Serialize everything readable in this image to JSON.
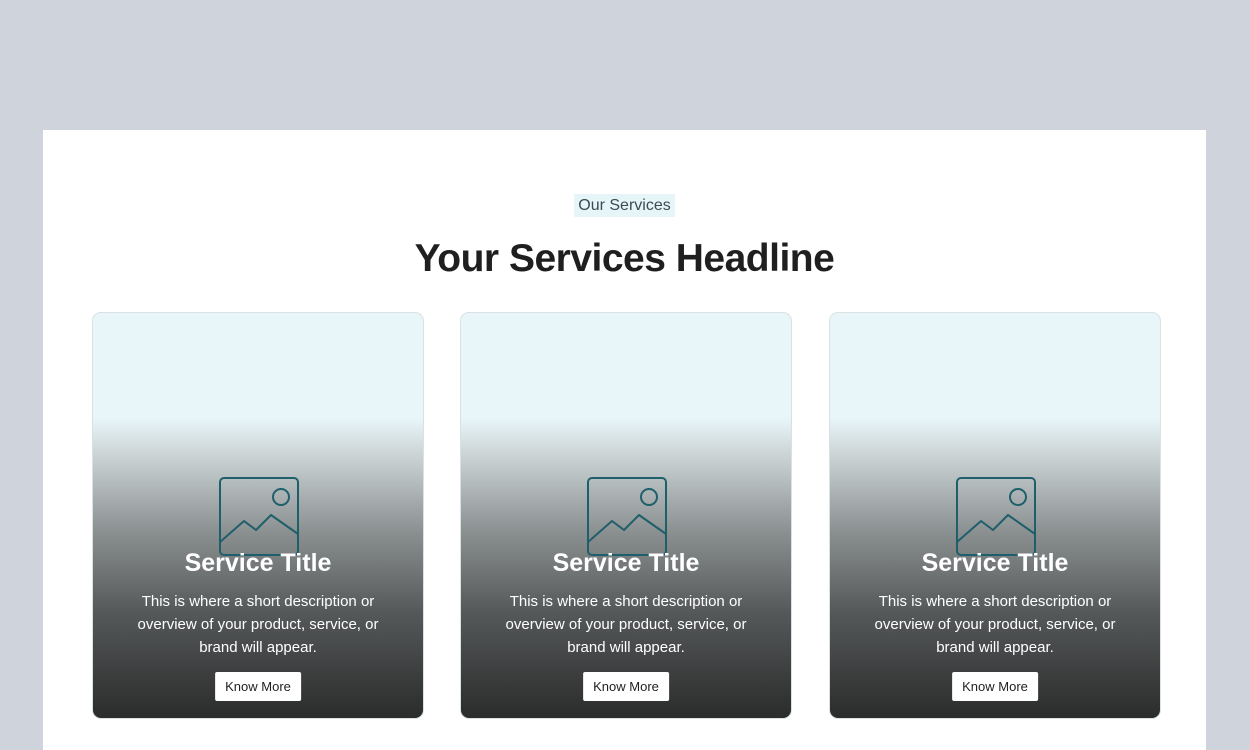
{
  "section": {
    "eyebrow": "Our Services",
    "headline": "Your Services Headline"
  },
  "cards": [
    {
      "icon": "image-placeholder-icon",
      "title": "Service Title",
      "description": "This is where a short description or overview of your product, service, or brand will appear.",
      "button_label": "Know More"
    },
    {
      "icon": "image-placeholder-icon",
      "title": "Service Title",
      "description": "This is where a short description or overview of your product, service, or brand will appear.",
      "button_label": "Know More"
    },
    {
      "icon": "image-placeholder-icon",
      "title": "Service Title",
      "description": "This is where a short description or overview of your product, service, or brand will appear.",
      "button_label": "Know More"
    }
  ],
  "colors": {
    "page_background": "#cfd4dc",
    "panel_background": "#ffffff",
    "eyebrow_background": "#e6f6f8",
    "icon_stroke": "#1f5f6b",
    "card_top": "#e8f6f9",
    "card_bottom": "#2a2b2b"
  }
}
